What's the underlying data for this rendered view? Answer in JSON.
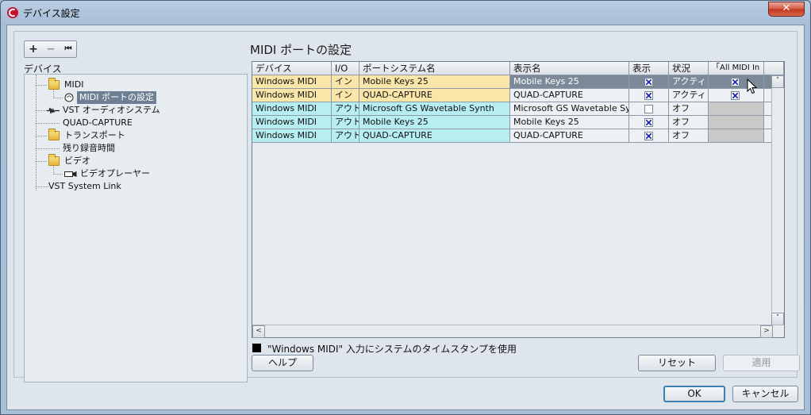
{
  "window": {
    "title": "デバイス設定",
    "close_glyph": "✕"
  },
  "toolbar": {
    "add_label": "+",
    "remove_label": "−",
    "reset_label": "⏮"
  },
  "tree": {
    "header": "デバイス",
    "items": [
      {
        "label": "MIDI"
      },
      {
        "label": "MIDI ポートの設定"
      },
      {
        "label": "VST オーディオシステム"
      },
      {
        "label": "QUAD-CAPTURE"
      },
      {
        "label": "トランスポート"
      },
      {
        "label": "残り録音時間"
      },
      {
        "label": "ビデオ"
      },
      {
        "label": "ビデオプレーヤー"
      },
      {
        "label": "VST System Link"
      }
    ]
  },
  "panel": {
    "title": "MIDI ポートの設定"
  },
  "table": {
    "columns": [
      "デバイス",
      "I/O",
      "ポートシステム名",
      "表示名",
      "表示",
      "状況",
      "「All MIDI In"
    ],
    "rows": [
      {
        "device": "Windows MIDI",
        "io": "イン",
        "port": "Mobile Keys 25",
        "display": "Mobile Keys 25",
        "visible": true,
        "status": "アクティ",
        "all_midi": true,
        "kind": "in"
      },
      {
        "device": "Windows MIDI",
        "io": "イン",
        "port": "QUAD-CAPTURE",
        "display": "QUAD-CAPTURE",
        "visible": true,
        "status": "アクティ",
        "all_midi": true,
        "kind": "in"
      },
      {
        "device": "Windows MIDI",
        "io": "アウト",
        "port": "Microsoft GS Wavetable Synth",
        "display": "Microsoft GS Wavetable Synth",
        "visible": false,
        "status": "オフ",
        "all_midi": null,
        "kind": "out"
      },
      {
        "device": "Windows MIDI",
        "io": "アウト",
        "port": "Mobile Keys 25",
        "display": "Mobile Keys 25",
        "visible": true,
        "status": "オフ",
        "all_midi": null,
        "kind": "out"
      },
      {
        "device": "Windows MIDI",
        "io": "アウト",
        "port": "QUAD-CAPTURE",
        "display": "QUAD-CAPTURE",
        "visible": true,
        "status": "オフ",
        "all_midi": null,
        "kind": "out"
      }
    ]
  },
  "options": {
    "timestamp_label": "\"Windows MIDI\" 入力にシステムのタイムスタンプを使用",
    "timestamp_checked": true
  },
  "buttons": {
    "help": "ヘルプ",
    "reset": "リセット",
    "apply": "適用",
    "ok": "OK",
    "cancel": "キャンセル"
  },
  "scroll": {
    "up": "˄",
    "down": "˅",
    "left": "<",
    "right": ">"
  }
}
